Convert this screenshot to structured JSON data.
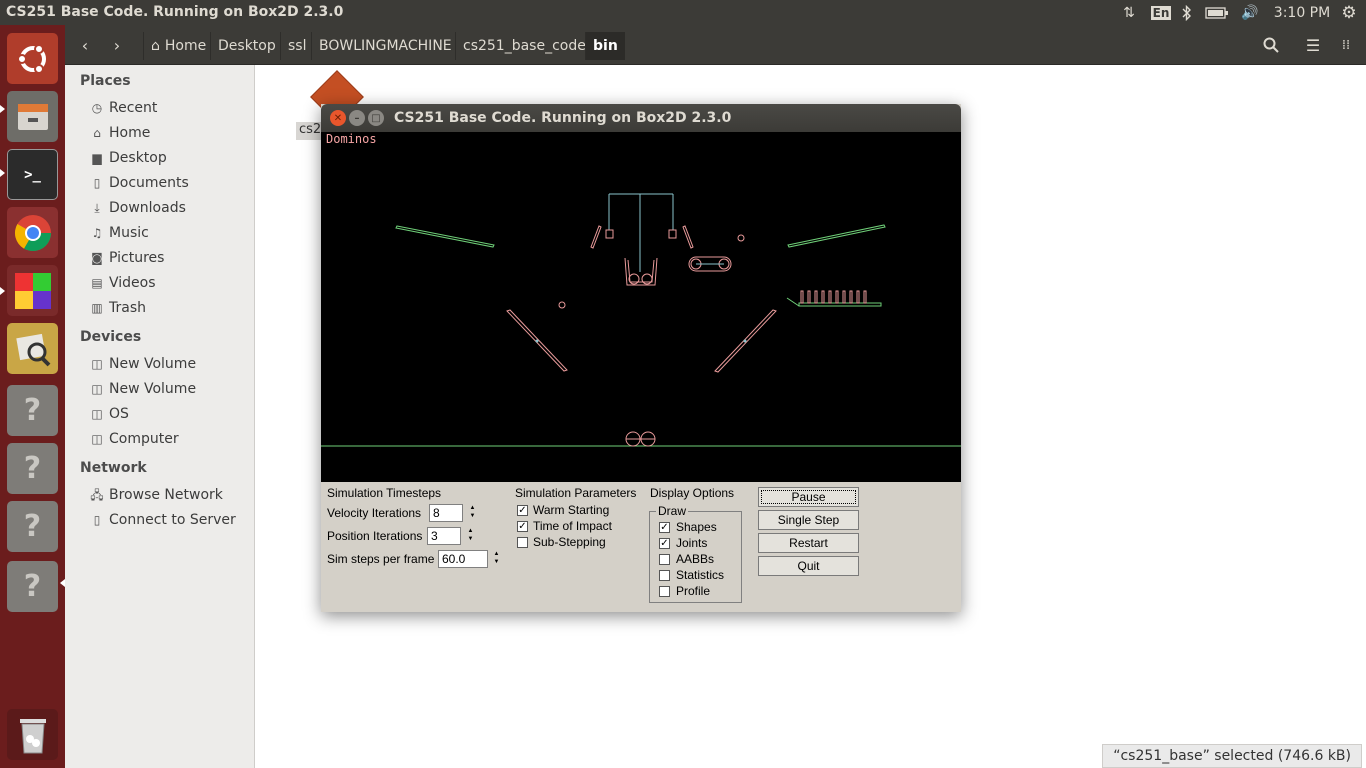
{
  "top_panel": {
    "window_title": "CS251 Base Code. Running on Box2D 2.3.0",
    "keyboard_layout": "En",
    "clock": "3:10 PM",
    "icons": [
      "network-updown-icon",
      "keyboard-layout-icon",
      "bluetooth-icon",
      "battery-icon",
      "volume-icon",
      "system-gear-icon"
    ]
  },
  "launcher": {
    "items": [
      "ubuntu-dash-icon",
      "files-icon",
      "terminal-icon",
      "chrome-icon",
      "app-squares-icon",
      "image-viewer-icon",
      "unknown-app-icon",
      "unknown-app-icon",
      "unknown-app-icon",
      "unknown-app-icon",
      "trash-icon"
    ]
  },
  "file_manager": {
    "breadcrumbs": [
      "Home",
      "Desktop",
      "ssl",
      "BOWLINGMACHINE",
      "cs251_base_code",
      "bin"
    ],
    "active_crumb": "bin",
    "sidebar": {
      "places_heading": "Places",
      "places": [
        "Recent",
        "Home",
        "Desktop",
        "Documents",
        "Downloads",
        "Music",
        "Pictures",
        "Videos",
        "Trash"
      ],
      "devices_heading": "Devices",
      "devices": [
        "New Volume",
        "New Volume",
        "OS",
        "Computer"
      ],
      "network_heading": "Network",
      "network": [
        "Browse Network",
        "Connect to Server"
      ]
    },
    "desktop_item_label": "cs2",
    "status": "“cs251_base” selected  (746.6 kB)"
  },
  "app_window": {
    "title": "CS251 Base Code. Running on Box2D 2.3.0",
    "scene_name": "Dominos",
    "panel": {
      "sim_timesteps": "Simulation Timesteps",
      "velocity_label": "Velocity Iterations",
      "velocity_value": "8",
      "position_label": "Position Iterations",
      "position_value": "3",
      "steps_label": "Sim steps per frame",
      "steps_value": "60.0",
      "sim_params": "Simulation Parameters",
      "warm_starting": "Warm Starting",
      "time_of_impact": "Time of Impact",
      "sub_stepping": "Sub-Stepping",
      "display_options": "Display Options",
      "draw": "Draw",
      "shapes": "Shapes",
      "joints": "Joints",
      "aabbs": "AABBs",
      "statistics": "Statistics",
      "profile": "Profile",
      "pause": "Pause",
      "single_step": "Single Step",
      "restart": "Restart",
      "quit": "Quit"
    },
    "checks": {
      "warm_starting": true,
      "time_of_impact": true,
      "sub_stepping": false,
      "shapes": true,
      "joints": true,
      "aabbs": false,
      "statistics": false,
      "profile": false
    },
    "colors": {
      "static_shapes": "#6fcf78",
      "dynamic_shapes": "#e89a9a",
      "joints": "#8ac4cc"
    }
  }
}
